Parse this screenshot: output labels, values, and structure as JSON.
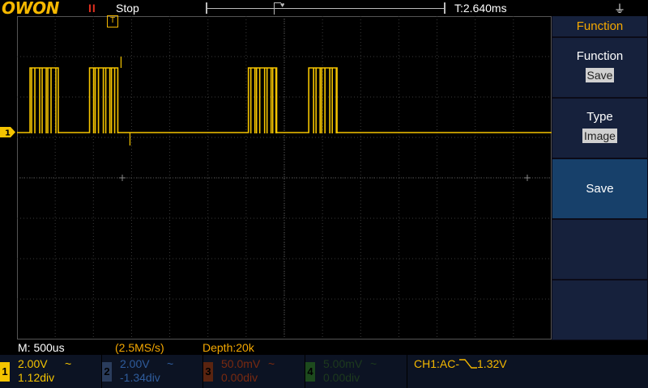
{
  "header": {
    "logo": "OWON",
    "run_state_icon": "pause-icon",
    "run_state_symbol": "II",
    "run_state": "Stop",
    "time_offset": "T:2.640ms",
    "usb_icon": "usb-icon"
  },
  "menu": {
    "title": "Function",
    "items": [
      {
        "label": "Function",
        "value": "Save"
      },
      {
        "label": "Type",
        "value": "Image"
      },
      {
        "label": "Save",
        "value": ""
      },
      {
        "label": "",
        "value": ""
      },
      {
        "label": "",
        "value": ""
      }
    ]
  },
  "status": {
    "timebase": "M: 500us",
    "sample_rate": "(2.5MS/s)",
    "depth": "Depth:20k"
  },
  "channels": [
    {
      "num": "1",
      "volt": "2.00V",
      "coupling": "~",
      "position": "1.12div",
      "color": "#f5c400",
      "active": true
    },
    {
      "num": "2",
      "volt": "2.00V",
      "coupling": "~",
      "position": "-1.34div",
      "color": "#1f4a8a",
      "active": false
    },
    {
      "num": "3",
      "volt": "50.0mV",
      "coupling": "~",
      "position": "0.00div",
      "color": "#7a2a10",
      "active": false
    },
    {
      "num": "4",
      "volt": "5.00mV",
      "coupling": "~",
      "position": "0.00div",
      "color": "#1d4a1d",
      "active": false
    }
  ],
  "trigger": {
    "text": "CH1:AC-⧵⎴1.32V",
    "source": "CH1:AC-",
    "slope_icon": "falling-edge-icon",
    "level": "1.32V"
  },
  "markers": {
    "trigger_position": "T",
    "ch1_marker": "1"
  },
  "colors": {
    "ch1": "#f5c400",
    "accent": "#f5a800",
    "menu_bg": "#16213c",
    "menu_active": "#17406a"
  },
  "waveform": {
    "baseline_level_div": -1.12,
    "burst_high_div": 1.6,
    "bursts_start_ms": [
      0.17,
      0.95,
      3.03,
      3.82
    ],
    "burst_width_ms": 0.37,
    "horizontal_div": 14,
    "vertical_div": 8
  }
}
